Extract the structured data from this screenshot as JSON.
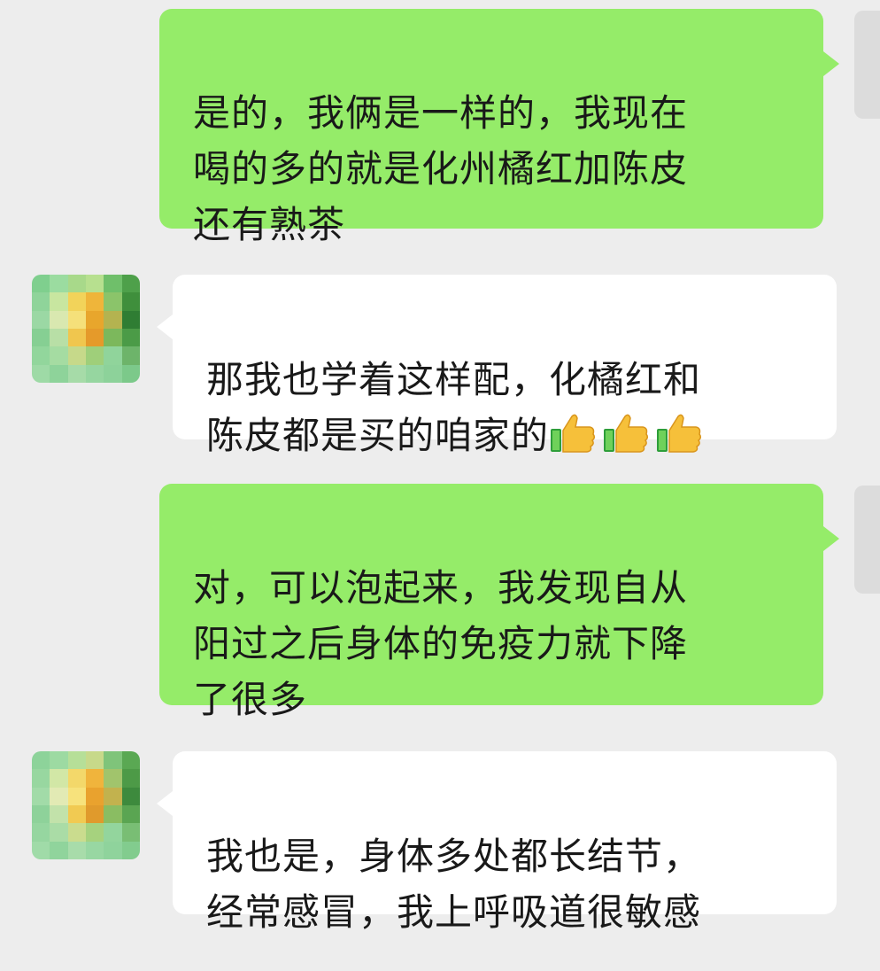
{
  "messages": [
    {
      "from": "me",
      "text": "是的，我俩是一样的，我现在\n喝的多的就是化州橘红加陈皮\n还有熟茶"
    },
    {
      "from": "other",
      "text": "那我也学着这样配，化橘红和\n陈皮都是买的咱家的",
      "emoji": [
        "thumbs-up",
        "thumbs-up",
        "thumbs-up"
      ]
    },
    {
      "from": "me",
      "text": "对，可以泡起来，我发现自从\n阳过之后身体的免疫力就下降\n了很多"
    },
    {
      "from": "other",
      "text": "我也是，身体多处都长结节，\n经常感冒，我上呼吸道很敏感"
    }
  ],
  "colors": {
    "background": "#ededed",
    "own_bubble": "#95ec69",
    "other_bubble": "#ffffff",
    "text": "#191919"
  }
}
